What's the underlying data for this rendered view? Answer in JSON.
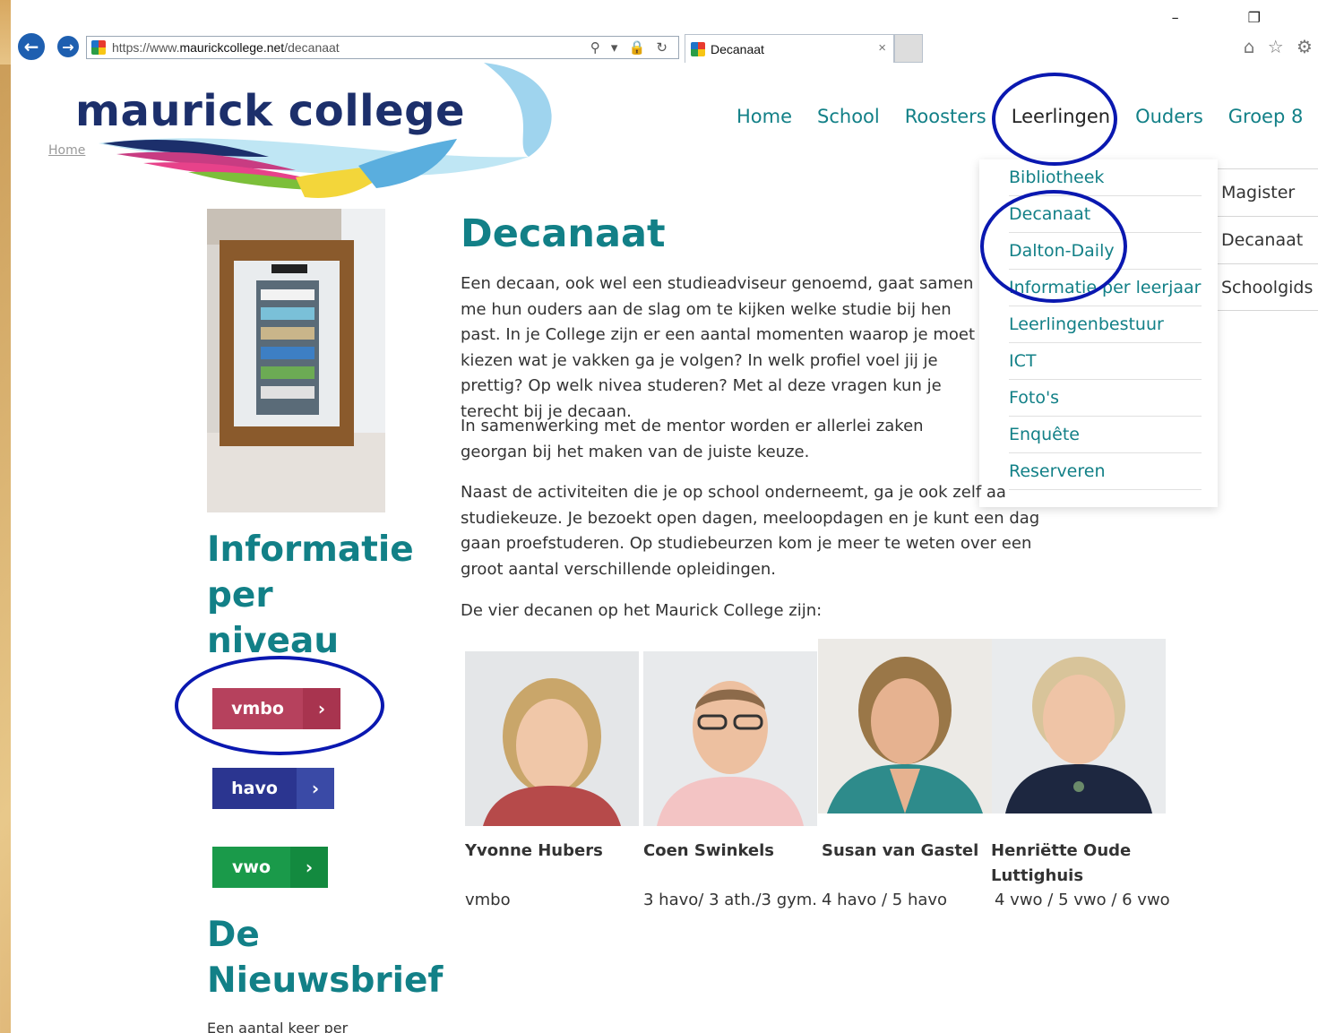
{
  "browser": {
    "url_prefix": "https://www.",
    "url_domain": "maurickcollege.net",
    "url_path": "/decanaat",
    "tab_title": "Decanaat",
    "tab_close": "×",
    "addr_icons": "⚲ ▾ 🔒 ↻",
    "win_controls": "– ❐",
    "toolbar_icons": "⌂ ☆ ⚙"
  },
  "site": {
    "logo": "maurick college",
    "breadcrumb": "Home"
  },
  "nav": {
    "items": [
      "Home",
      "School",
      "Roosters",
      "Leerlingen",
      "Ouders",
      "Groep 8"
    ],
    "active": "Leerlingen"
  },
  "dropdown": {
    "items": [
      "Bibliotheek",
      "Decanaat",
      "Dalton-Daily",
      "Informatie per leerjaar",
      "Leerlingenbestuur",
      "ICT",
      "Foto's",
      "Enquête",
      "Reserveren"
    ]
  },
  "side_menu": {
    "items": [
      "Magister",
      "Decanaat",
      "Schoolgids"
    ]
  },
  "left": {
    "heading_info": [
      "Informatie",
      "per",
      "niveau"
    ],
    "buttons": [
      {
        "label": "vmbo",
        "arrow": "›",
        "color": "#b6415d",
        "arrow_color": "#a8344f"
      },
      {
        "label": "havo",
        "arrow": "›",
        "color": "#2b3590",
        "arrow_color": "#3a4aa6"
      },
      {
        "label": "vwo",
        "arrow": "›",
        "color": "#1a9a4a",
        "arrow_color": "#138a3f"
      }
    ],
    "heading_news": [
      "De",
      "Nieuwsbrief"
    ],
    "news_text": "Een aantal keer per"
  },
  "content": {
    "title": "Decanaat",
    "paragraphs": [
      "Een decaan, ook wel een studieadviseur genoemd, gaat samen me hun ouders aan de slag om te kijken welke studie bij hen past. In je College zijn er een aantal momenten waarop je moet kiezen wat je vakken ga je volgen? In welk profiel voel jij je prettig? Op welk nivea studeren? Met al deze vragen kun je terecht bij je decaan.",
      "In samenwerking met de mentor worden er allerlei zaken georgan bij het maken van de juiste keuze.",
      "Naast de activiteiten die je op school onderneemt, ga je ook zelf aa studiekeuze. Je bezoekt open dagen, meeloopdagen en je kunt een dag gaan proefstuderen. Op studiebeurzen kom je meer te weten over een groot aantal verschillende opleidingen.",
      "De vier decanen op het Maurick College zijn:"
    ],
    "people": [
      {
        "name": "Yvonne   Hubers",
        "level": "vmbo"
      },
      {
        "name": "Coen  Swinkels",
        "level": "3 havo/ 3 ath./3 gym."
      },
      {
        "name": "Susan van Gastel",
        "level": "4 havo / 5 havo"
      },
      {
        "name": "Henriëtte Oude Luttighuis",
        "level": "4 vwo / 5 vwo / 6 vwo"
      }
    ]
  },
  "colors": {
    "teal": "#128087",
    "navy": "#1c2f6b",
    "annotation": "#0a18b0"
  }
}
